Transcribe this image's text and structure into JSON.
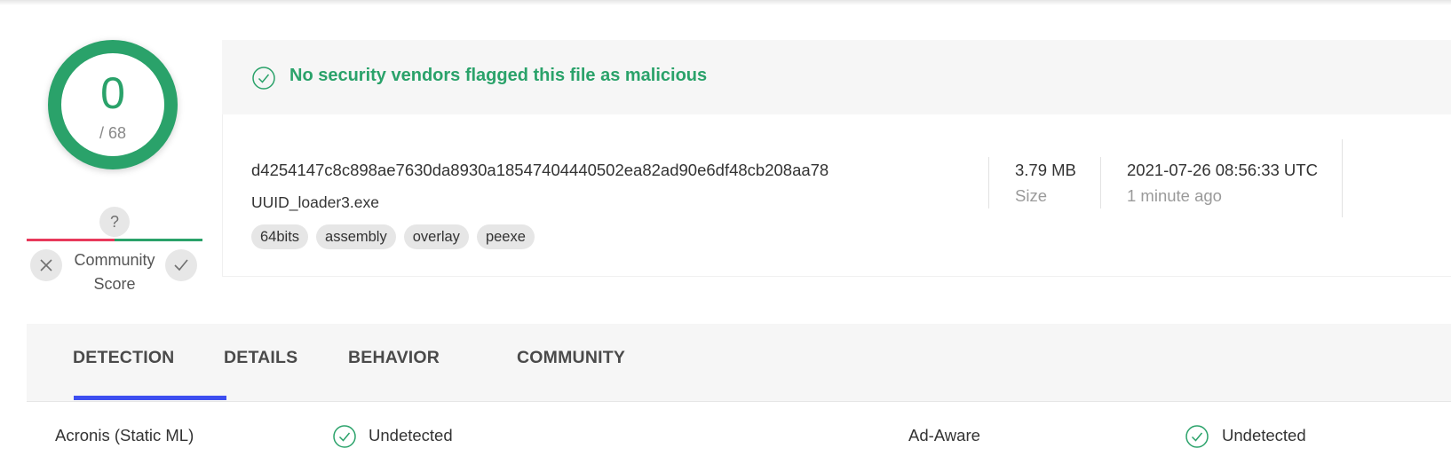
{
  "score": {
    "value": "0",
    "total": "/ 68",
    "color": "#2aa26a"
  },
  "community": {
    "unknown_symbol": "?",
    "label_line1": "Community",
    "label_line2": "Score",
    "bad_color": "#e8395b",
    "good_color": "#2aa26a"
  },
  "banner": {
    "message": "No security vendors flagged this file as malicious",
    "icon": "check-circle-icon"
  },
  "file": {
    "hash": "d4254147c8c898ae7630da8930a18547404440502ea82ad90e6df48cb208aa78",
    "name": "UUID_loader3.exe",
    "tags": [
      "64bits",
      "assembly",
      "overlay",
      "peexe"
    ],
    "size_value": "3.79 MB",
    "size_label": "Size",
    "date_value": "2021-07-26 08:56:33 UTC",
    "date_relative": "1 minute ago"
  },
  "tabs": [
    {
      "label": "DETECTION",
      "active": true
    },
    {
      "label": "DETAILS",
      "active": false
    },
    {
      "label": "BEHAVIOR",
      "active": false
    },
    {
      "label": "COMMUNITY",
      "active": false
    }
  ],
  "tab_indicator_color": "#3d4ef0",
  "detections": [
    {
      "vendor": "Acronis (Static ML)",
      "status": "Undetected"
    },
    {
      "vendor": "Ad-Aware",
      "status": "Undetected"
    }
  ]
}
